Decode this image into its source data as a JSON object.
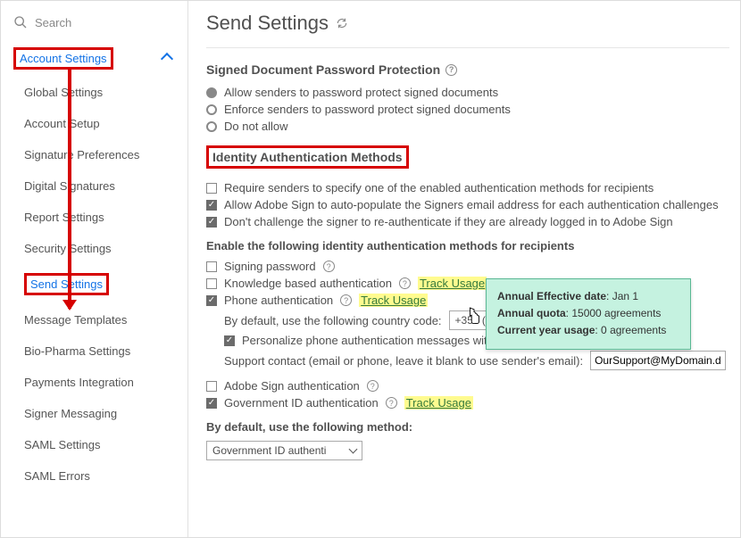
{
  "search": {
    "placeholder": "Search"
  },
  "sidebar": {
    "header": "Account Settings",
    "items": [
      {
        "label": "Global Settings"
      },
      {
        "label": "Account Setup"
      },
      {
        "label": "Signature Preferences"
      },
      {
        "label": "Digital Signatures"
      },
      {
        "label": "Report Settings"
      },
      {
        "label": "Security Settings"
      },
      {
        "label": "Send Settings"
      },
      {
        "label": "Message Templates"
      },
      {
        "label": "Bio-Pharma Settings"
      },
      {
        "label": "Payments Integration"
      },
      {
        "label": "Signer Messaging"
      },
      {
        "label": "SAML Settings"
      },
      {
        "label": "SAML Errors"
      }
    ]
  },
  "page": {
    "title": "Send Settings"
  },
  "pwd": {
    "heading": "Signed Document Password Protection",
    "opt1": "Allow senders to password protect signed documents",
    "opt2": "Enforce senders to password protect signed documents",
    "opt3": "Do not allow"
  },
  "idauth": {
    "heading": "Identity Authentication Methods",
    "chk1": "Require senders to specify one of the enabled authentication methods for recipients",
    "chk2": "Allow Adobe Sign to auto-populate the Signers email address for each authentication challenges",
    "chk3": "Don't challenge the signer to re-authenticate if they are already logged in to Adobe Sign",
    "enable_heading": "Enable the following identity authentication methods for recipients",
    "signing_pwd": "Signing password",
    "kba": "Knowledge based authentication",
    "phone": "Phone authentication",
    "track": "Track Usage",
    "default_cc_label": "By default, use the following country code:",
    "country_code": "+353 (Ireland)",
    "personalize": "Personalize phone authentication messages with your company name",
    "support_label": "Support contact (email or phone, leave it blank to use sender's email):",
    "support_value": "OurSupport@MyDomain.dom",
    "adobe_auth": "Adobe Sign authentication",
    "gov_auth": "Government ID authentication",
    "default_method_label": "By default, use the following method:",
    "default_method_value": "Government ID authenti"
  },
  "tooltip": {
    "l1a": "Annual Effective date",
    "l1b": ": Jan 1",
    "l2a": "Annual quota",
    "l2b": ": 15000 agreements",
    "l3a": "Current year usage",
    "l3b": ": 0 agreements"
  }
}
